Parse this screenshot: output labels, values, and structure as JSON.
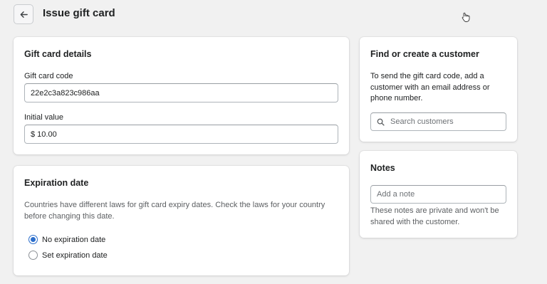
{
  "header": {
    "title": "Issue gift card"
  },
  "gift_card_details": {
    "title": "Gift card details",
    "code_label": "Gift card code",
    "code_value": "22e2c3a823c986aa",
    "initial_value_label": "Initial value",
    "initial_value": "$ 10.00"
  },
  "expiration": {
    "title": "Expiration date",
    "description": "Countries have different laws for gift card expiry dates. Check the laws for your country before changing this date.",
    "options": [
      {
        "label": "No expiration date",
        "selected": true
      },
      {
        "label": "Set expiration date",
        "selected": false
      }
    ]
  },
  "customer": {
    "title": "Find or create a customer",
    "description": "To send the gift card code, add a customer with an email address or phone number.",
    "search_placeholder": "Search customers"
  },
  "notes": {
    "title": "Notes",
    "placeholder": "Add a note",
    "helper": "These notes are private and won't be shared with the customer."
  },
  "colors": {
    "accent": "#2c6ecb",
    "background": "#f1f1f1",
    "card": "#ffffff"
  },
  "icons": [
    "arrow-left-icon",
    "search-icon",
    "cursor-icon"
  ]
}
